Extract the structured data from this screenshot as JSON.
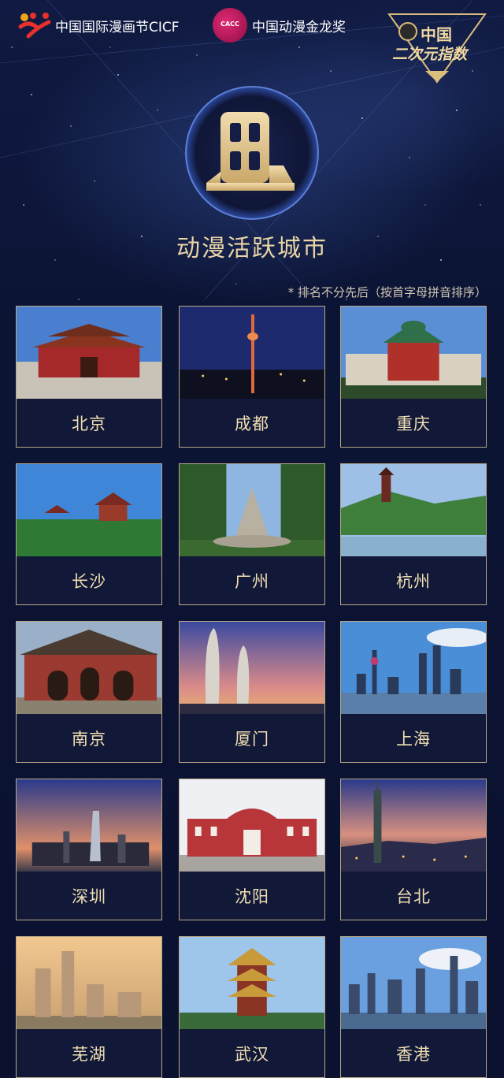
{
  "header": {
    "logo1_text": "中国国际漫画节CICF",
    "logo2_badge": "CACC",
    "logo2_text": "中国动漫金龙奖",
    "badge_title": "中国",
    "badge_subtitle": "二次元指数"
  },
  "section": {
    "title": "动漫活跃城市",
    "note": "* 排名不分先后（按首字母拼音排序）"
  },
  "cities": [
    {
      "name": "北京"
    },
    {
      "name": "成都"
    },
    {
      "name": "重庆"
    },
    {
      "name": "长沙"
    },
    {
      "name": "广州"
    },
    {
      "name": "杭州"
    },
    {
      "name": "南京"
    },
    {
      "name": "厦门"
    },
    {
      "name": "上海"
    },
    {
      "name": "深圳"
    },
    {
      "name": "沈阳"
    },
    {
      "name": "台北"
    },
    {
      "name": "芜湖"
    },
    {
      "name": "武汉"
    },
    {
      "name": "香港"
    }
  ],
  "colors": {
    "background": "#0d1330",
    "gold": "#e9d4a6",
    "card_border": "#b9a887"
  }
}
